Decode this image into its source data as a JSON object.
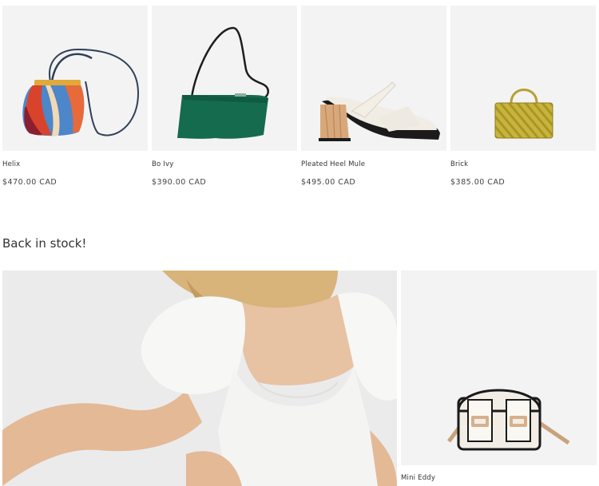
{
  "products": [
    {
      "name": "Helix",
      "price": "$470.00 CAD",
      "image": "helix-bag"
    },
    {
      "name": "Bo Ivy",
      "price": "$390.00 CAD",
      "image": "bo-ivy-bag"
    },
    {
      "name": "Pleated Heel Mule",
      "price": "$495.00 CAD",
      "image": "pleated-heel-mule-shoe"
    },
    {
      "name": "Brick",
      "price": "$385.00 CAD",
      "image": "brick-bag"
    }
  ],
  "section": {
    "title": "Back in stock!"
  },
  "featured": {
    "hero_image": "model-in-white-bodysuit",
    "product": {
      "name": "Mini Eddy",
      "image": "mini-eddy-bag"
    }
  },
  "colors": {
    "card_background": "#f3f3f3",
    "text": "#333333",
    "helix_red": "#d9432b",
    "helix_blue": "#4d86c9",
    "bo_ivy_green": "#156b4d",
    "brick_yellow": "#c9b43a"
  }
}
